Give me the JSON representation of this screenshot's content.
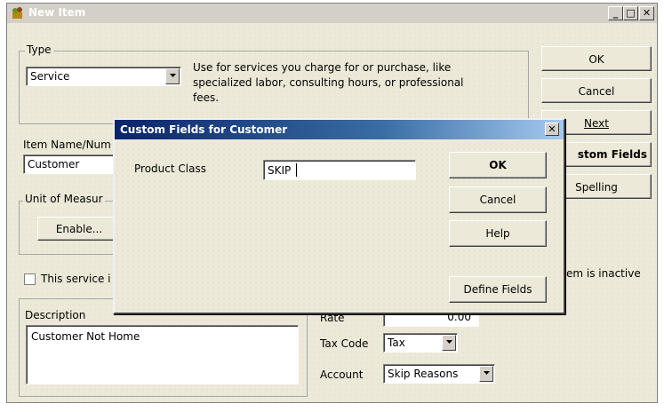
{
  "window": {
    "title": "New Item"
  },
  "type_group": {
    "label": "Type",
    "selected": "Service",
    "description": [
      "Use for services you charge for or purchase, like",
      "specialized labor, consulting hours, or professional",
      "fees."
    ]
  },
  "item_name": {
    "label": "Item Name/Num",
    "value": "Customer"
  },
  "unit_of_measure": {
    "label": "Unit of Measur",
    "enable_label": "Enable..."
  },
  "subcheck": {
    "label": "This service i",
    "checked": false
  },
  "description": {
    "label": "Description",
    "value": "Customer Not Home"
  },
  "rate": {
    "label": "Rate",
    "value": "0.00"
  },
  "tax_code": {
    "label": "Tax Code",
    "value": "Tax"
  },
  "account": {
    "label": "Account",
    "value": "Skip Reasons"
  },
  "side_buttons": {
    "ok": "OK",
    "cancel": "Cancel",
    "next": "Next",
    "custom_fields": "stom Fields",
    "spelling": "Spelling"
  },
  "inactive_label": "em is inactive",
  "dialog": {
    "title": "Custom Fields for Customer",
    "field_label": "Product Class",
    "field_value": "SKIP",
    "ok": "OK",
    "cancel": "Cancel",
    "help": "Help",
    "define_fields": "Define Fields"
  }
}
